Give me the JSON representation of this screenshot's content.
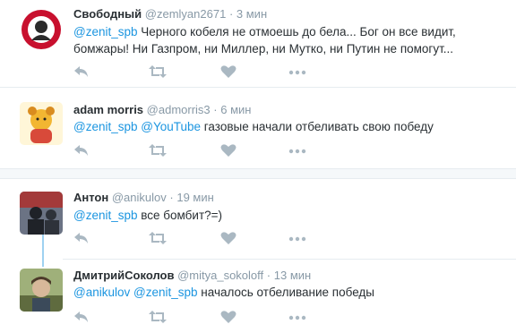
{
  "tweets": [
    {
      "name": "Свободный",
      "handle": "@zemlyan2671",
      "time": "3 мин",
      "avatar_colors": {
        "bg": "#c8102e",
        "ring": "#ffffff"
      },
      "lines": [
        {
          "mentions": [
            "@zenit_spb"
          ],
          "text": "Черного кобеля не отмоешь до бела... Бог он все видит,"
        },
        {
          "mentions": [],
          "text": "бомжары! Ни Газпром, ни Миллер, ни Мутко, ни Путин не помогут..."
        }
      ]
    },
    {
      "name": "adam morris",
      "handle": "@admorris3",
      "time": "6 мин",
      "avatar_colors": {
        "bg": "#f2d15a",
        "ring": "#d98c1f"
      },
      "lines": [
        {
          "mentions": [
            "@zenit_spb",
            "@YouTube"
          ],
          "text": "газовые начали отбеливать свою победу"
        }
      ]
    },
    {
      "name": "Антон",
      "handle": "@anikulov",
      "time": "19 мин",
      "avatar_colors": {
        "bg": "#4a4f5a",
        "ring": "#a33a3a"
      },
      "lines": [
        {
          "mentions": [
            "@zenit_spb"
          ],
          "text": "все бомбит?=)"
        }
      ]
    },
    {
      "name": "ДмитрийСоколов",
      "handle": "@mitya_sokoloff",
      "time": "13 мин",
      "avatar_colors": {
        "bg": "#7f9a5a",
        "ring": "#4c3a2a"
      },
      "lines": [
        {
          "mentions": [
            "@anikulov",
            "@zenit_spb"
          ],
          "text": "началось отбеливание победы"
        }
      ]
    }
  ],
  "dot": "·",
  "icons": [
    "reply-icon",
    "retweet-icon",
    "like-icon",
    "more-icon"
  ],
  "colors": {
    "mention": "#1b95e0",
    "meta": "#8899a6",
    "icon": "#aab8c2",
    "thread": "#9fd1f1"
  }
}
